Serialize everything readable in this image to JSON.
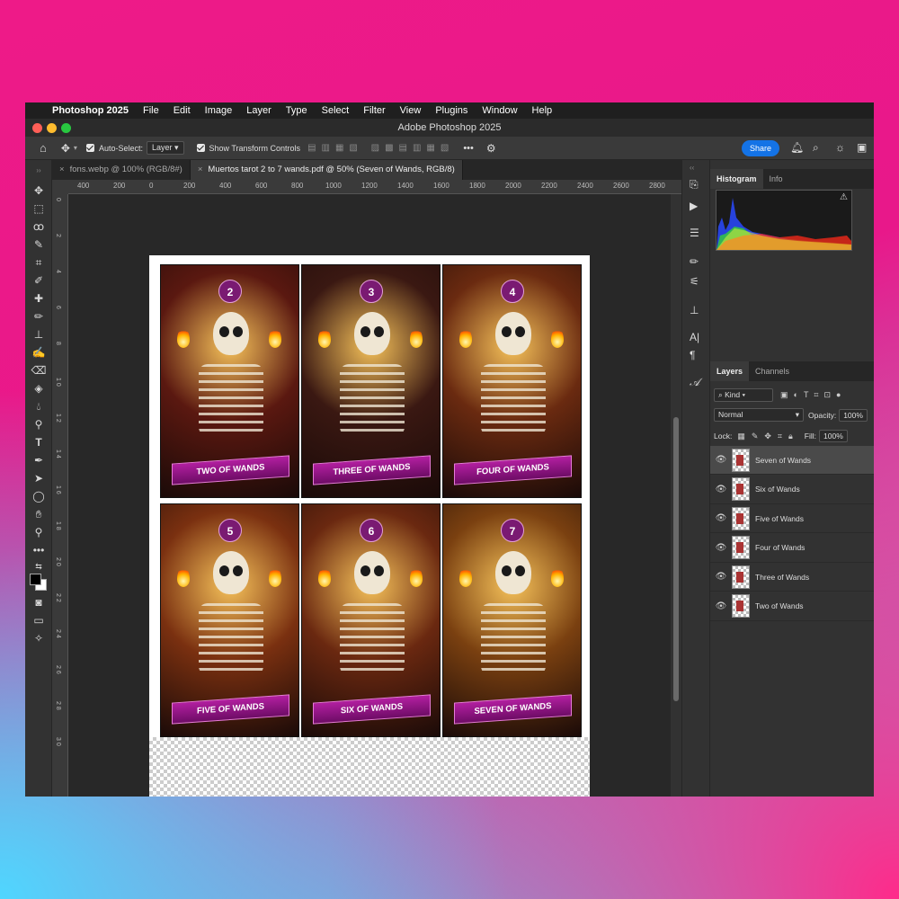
{
  "menubar": {
    "app_name": "Photoshop 2025",
    "items": [
      "File",
      "Edit",
      "Image",
      "Layer",
      "Type",
      "Select",
      "Filter",
      "View",
      "Plugins",
      "Window",
      "Help"
    ]
  },
  "window": {
    "title": "Adobe Photoshop 2025"
  },
  "options": {
    "auto_select_label": "Auto-Select:",
    "auto_select_value": "Layer",
    "transform_label": "Show Transform Controls",
    "share_label": "Share",
    "more_label": "•••"
  },
  "tabs": [
    {
      "label": "fons.webp @ 100% (RGB/8#)"
    },
    {
      "label": "Muertos tarot 2 to 7 wands.pdf @ 50% (Seven of Wands, RGB/8)"
    }
  ],
  "ruler": {
    "h_ticks": [
      "400",
      "200",
      "0",
      "200",
      "400",
      "600",
      "800",
      "1000",
      "1200",
      "1400",
      "1600",
      "1800",
      "2000",
      "2200",
      "2400",
      "2600",
      "2800"
    ],
    "v_ticks": [
      "0",
      "2",
      "4",
      "6",
      "8",
      "1 0",
      "1 2",
      "1 4",
      "1 6",
      "1 8",
      "2 0",
      "2 2",
      "2 4",
      "2 6",
      "2 8",
      "3 0"
    ]
  },
  "cards": [
    {
      "number": "2",
      "title": "TWO OF WANDS",
      "bg": "#5a1810"
    },
    {
      "number": "3",
      "title": "THREE OF WANDS",
      "bg": "#3a1812"
    },
    {
      "number": "4",
      "title": "FOUR OF WANDS",
      "bg": "#6a2a10"
    },
    {
      "number": "5",
      "title": "FIVE OF WANDS",
      "bg": "#7a3010"
    },
    {
      "number": "6",
      "title": "SIX OF WANDS",
      "bg": "#6a2810"
    },
    {
      "number": "7",
      "title": "SEVEN OF WANDS",
      "bg": "#7a4010"
    }
  ],
  "panel": {
    "histogram_tab": "Histogram",
    "info_tab": "Info",
    "layers_tab": "Layers",
    "channels_tab": "Channels",
    "kind_label": "Kind",
    "blend_mode": "Normal",
    "opacity_label": "Opacity:",
    "opacity_value": "100%",
    "lock_label": "Lock:",
    "fill_label": "Fill:",
    "fill_value": "100%"
  },
  "layers": [
    {
      "name": "Seven of Wands"
    },
    {
      "name": "Six of Wands"
    },
    {
      "name": "Five of Wands"
    },
    {
      "name": "Four of Wands"
    },
    {
      "name": "Three of Wands"
    },
    {
      "name": "Two of Wands"
    }
  ],
  "colors": {
    "accent": "#1473e6",
    "banner": "#9a1a8c"
  }
}
